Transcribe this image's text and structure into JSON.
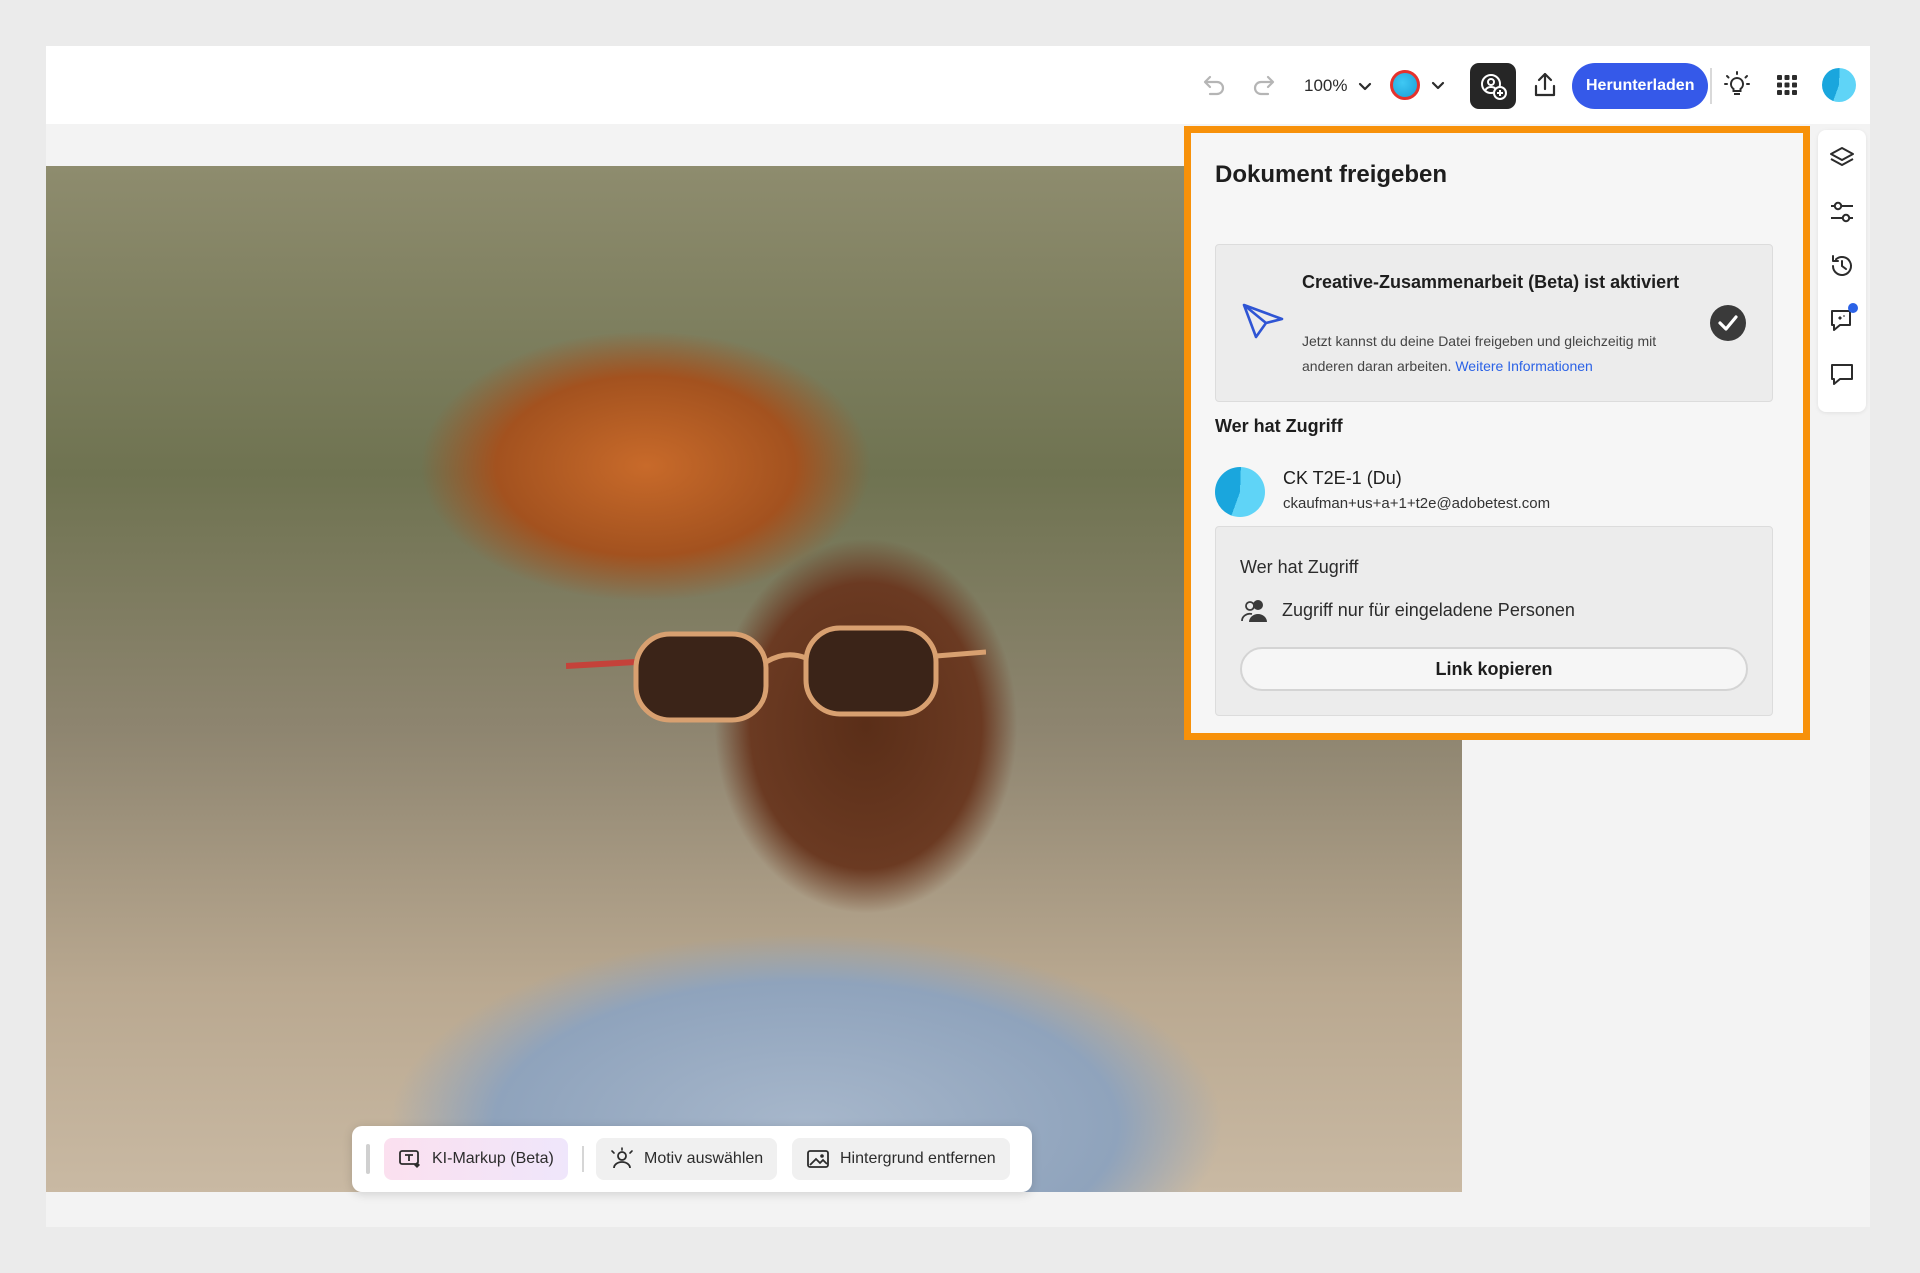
{
  "topbar": {
    "zoom": "100%",
    "download_label": "Herunterladen"
  },
  "colors": {
    "accent": "#3559e9",
    "highlight_border": "#f7910a",
    "link": "#2b62e6"
  },
  "share_panel": {
    "title": "Dokument freigeben",
    "collab_heading": "Creative-Zusammenarbeit (Beta) ist aktiviert",
    "collab_description": "Jetzt kannst du deine Datei freigeben und gleichzeitig mit anderen daran arbeiten.",
    "collab_link": "Weitere Informationen",
    "access_heading": "Wer hat Zugriff",
    "user": {
      "name": "CK T2E-1 (Du)",
      "email": "ckaufman+us+a+1+t2e@adobetest.com"
    },
    "access_card_heading": "Wer hat Zugriff",
    "access_mode": "Zugriff nur für eingeladene Personen",
    "copy_link_label": "Link kopieren"
  },
  "bottom_toolbar": {
    "ai_markup": "KI-Markup (Beta)",
    "select_subject": "Motiv auswählen",
    "remove_background": "Hintergrund entfernen"
  },
  "icons": {
    "undo": "undo-icon",
    "redo": "redo-icon",
    "collaborate": "collaborate-icon",
    "share": "upload-icon",
    "tips": "lightbulb-icon",
    "apps": "apps-grid-icon",
    "layers": "layers-icon",
    "adjust": "sliders-icon",
    "history": "history-icon",
    "comments_ai": "ai-chat-icon",
    "comments": "comment-icon"
  }
}
